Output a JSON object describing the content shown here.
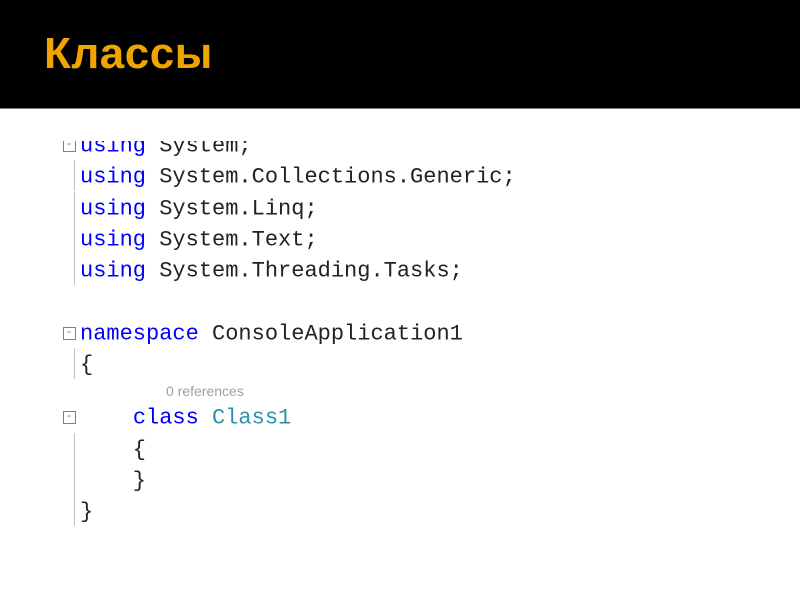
{
  "slide": {
    "title": "Классы"
  },
  "code": {
    "lines": [
      {
        "fold": "minus",
        "segments": [
          {
            "t": "using ",
            "c": "kw"
          },
          {
            "t": "System;",
            "c": "txt"
          }
        ],
        "cutTop": true
      },
      {
        "fold": "guide",
        "segments": [
          {
            "t": "using ",
            "c": "kw"
          },
          {
            "t": "System.Collections.Generic;",
            "c": "txt"
          }
        ]
      },
      {
        "fold": "guide",
        "segments": [
          {
            "t": "using ",
            "c": "kw"
          },
          {
            "t": "System.Linq;",
            "c": "txt"
          }
        ]
      },
      {
        "fold": "guide",
        "segments": [
          {
            "t": "using ",
            "c": "kw"
          },
          {
            "t": "System.Text;",
            "c": "txt"
          }
        ]
      },
      {
        "fold": "guide",
        "segments": [
          {
            "t": "using ",
            "c": "kw"
          },
          {
            "t": "System.Threading.Tasks;",
            "c": "txt"
          }
        ]
      },
      {
        "fold": "",
        "segments": [
          {
            "t": "",
            "c": "txt"
          }
        ]
      },
      {
        "fold": "minus",
        "segments": [
          {
            "t": "namespace ",
            "c": "kw"
          },
          {
            "t": "ConsoleApplication1",
            "c": "txt"
          }
        ]
      },
      {
        "fold": "guide",
        "segments": [
          {
            "t": "{",
            "c": "txt"
          }
        ]
      },
      {
        "fold": "ref",
        "ref": "0 references"
      },
      {
        "fold": "minus",
        "indent": 1,
        "segments": [
          {
            "t": "    ",
            "c": "txt"
          },
          {
            "t": "class ",
            "c": "kw"
          },
          {
            "t": "Class1",
            "c": "type"
          }
        ]
      },
      {
        "fold": "guide",
        "indent": 1,
        "segments": [
          {
            "t": "    {",
            "c": "txt"
          }
        ]
      },
      {
        "fold": "guide",
        "indent": 1,
        "segments": [
          {
            "t": "    }",
            "c": "txt"
          }
        ]
      },
      {
        "fold": "end",
        "segments": [
          {
            "t": "}",
            "c": "txt"
          }
        ]
      }
    ]
  }
}
